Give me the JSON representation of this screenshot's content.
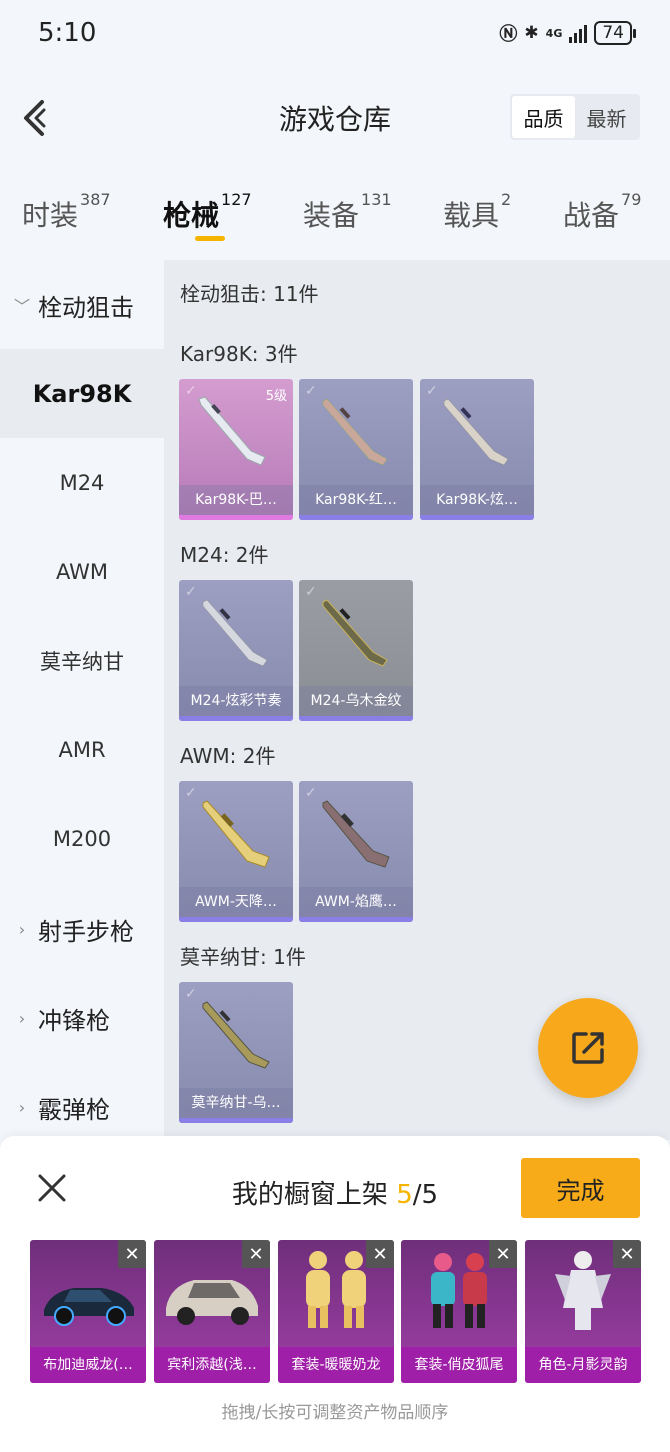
{
  "status_bar": {
    "time": "5:10",
    "network": "4G",
    "battery": "74"
  },
  "header": {
    "title": "游戏仓库",
    "sort": {
      "quality": "品质",
      "newest": "最新"
    }
  },
  "tabs": [
    {
      "label": "时装",
      "count": "387"
    },
    {
      "label": "枪械",
      "count": "127"
    },
    {
      "label": "装备",
      "count": "131"
    },
    {
      "label": "载具",
      "count": "2"
    },
    {
      "label": "战备",
      "count": "79"
    }
  ],
  "sidebar": {
    "group_bolt": "栓动狙击",
    "items": [
      "Kar98K",
      "M24",
      "AWM",
      "莫辛纳甘",
      "AMR",
      "M200"
    ],
    "group_marksman": "射手步枪",
    "group_smg": "冲锋枪",
    "group_shotgun": "霰弹枪"
  },
  "content": {
    "category_title": "栓动狙击: 11件",
    "sections": [
      {
        "title": "Kar98K: 3件",
        "items": [
          {
            "name": "Kar98K-巴…",
            "level": "5级"
          },
          {
            "name": "Kar98K-红…"
          },
          {
            "name": "Kar98K-炫…"
          }
        ]
      },
      {
        "title": "M24: 2件",
        "items": [
          {
            "name": "M24-炫彩节奏"
          },
          {
            "name": "M24-乌木金纹"
          }
        ]
      },
      {
        "title": "AWM: 2件",
        "items": [
          {
            "name": "AWM-天降…"
          },
          {
            "name": "AWM-焰鹰…"
          }
        ]
      },
      {
        "title": "莫辛纳甘: 1件",
        "items": [
          {
            "name": "莫辛纳甘-乌…"
          }
        ]
      }
    ]
  },
  "showcase": {
    "title_prefix": "我的橱窗上架",
    "count": "5",
    "total": "/5",
    "done_label": "完成",
    "slots": [
      "布加迪威龙(…",
      "宾利添越(浅…",
      "套装-暖暖奶龙",
      "套装-俏皮狐尾",
      "角色-月影灵韵"
    ],
    "hint": "拖拽/长按可调整资产物品顺序"
  },
  "colors": {
    "accent": "#f7ab18",
    "count_highlight": "#f5b400",
    "showcase_label": "#a01fa8"
  }
}
